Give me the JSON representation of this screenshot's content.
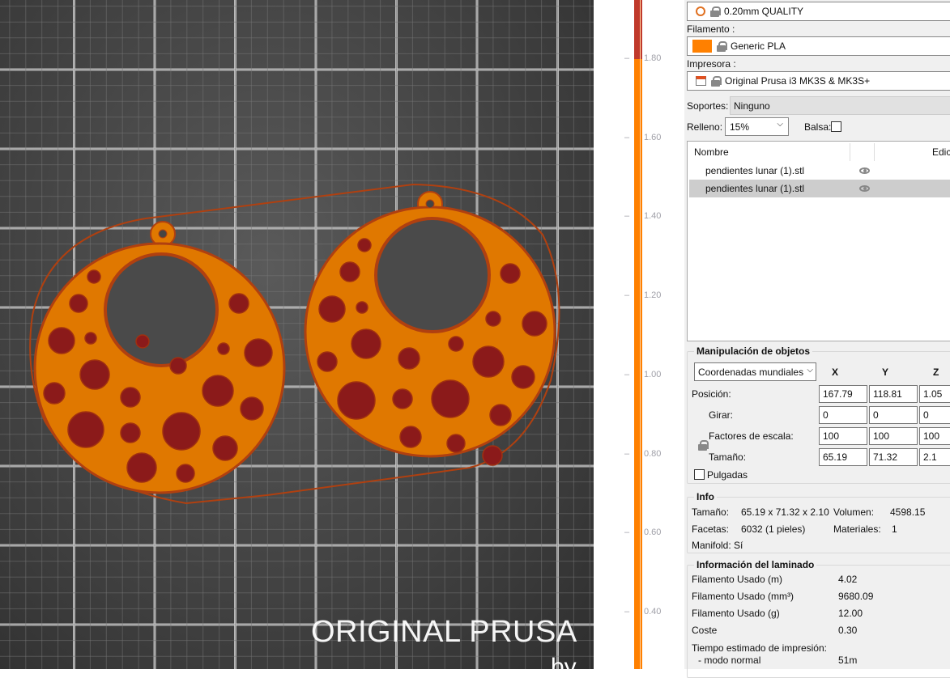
{
  "viewport": {
    "brand": "ORIGINAL PRUSA",
    "brand_sub": "by",
    "colors": {
      "model": "#e07800",
      "perimeter": "#b04010",
      "hole": "#8b1a1a"
    }
  },
  "slider": {
    "ticks": [
      "1.80",
      "1.60",
      "1.40",
      "1.20",
      "1.00",
      "0.80",
      "0.60",
      "0.40"
    ],
    "colors": {
      "active": "#ff8000",
      "done": "#c0392b"
    }
  },
  "presets": {
    "print": "0.20mm QUALITY",
    "filament_label": "Filamento :",
    "filament": "Generic PLA",
    "filament_color": "#ff8000",
    "printer_label": "Impresora :",
    "printer": "Original Prusa i3 MK3S & MK3S+",
    "supports_label": "Soportes:",
    "supports": "Ninguno",
    "infill_label": "Relleno:",
    "infill": "15%",
    "brim_label": "Balsa:"
  },
  "object_list": {
    "columns": [
      "Nombre",
      "",
      "Edic"
    ],
    "items": [
      {
        "name": "pendientes lunar (1).stl",
        "selected": false
      },
      {
        "name": "pendientes lunar (1).stl",
        "selected": true
      }
    ]
  },
  "manipulation": {
    "title": "Manipulación de objetos",
    "coords": "Coordenadas mundiales",
    "axes": [
      "X",
      "Y",
      "Z"
    ],
    "rows": [
      {
        "label": "Posición:",
        "values": [
          "167.79",
          "118.81",
          "1.05"
        ]
      },
      {
        "label": "Girar:",
        "values": [
          "0",
          "0",
          "0"
        ]
      },
      {
        "label": "Factores de escala:",
        "values": [
          "100",
          "100",
          "100"
        ]
      },
      {
        "label": "Tamaño:",
        "values": [
          "65.19",
          "71.32",
          "2.1"
        ]
      }
    ],
    "inches": "Pulgadas"
  },
  "info": {
    "title": "Info",
    "size_label": "Tamaño:",
    "size": "65.19 x 71.32 x 2.10",
    "volume_label": "Volumen:",
    "volume": "4598.15",
    "facets_label": "Facetas:",
    "facets": "6032 (1 pieles)",
    "materials_label": "Materiales:",
    "materials": "1",
    "manifold": "Manifold: Sí"
  },
  "slice": {
    "title": "Información del laminado",
    "rows": [
      {
        "label": "Filamento Usado (m)",
        "value": "4.02"
      },
      {
        "label": "Filamento Usado (mm³)",
        "value": "9680.09"
      },
      {
        "label": "Filamento Usado (g)",
        "value": "12.00"
      },
      {
        "label": "Coste",
        "value": "0.30"
      }
    ],
    "time_label": "Tiempo estimado de impresión:",
    "mode_label": "- modo normal",
    "mode_value": "51m"
  }
}
